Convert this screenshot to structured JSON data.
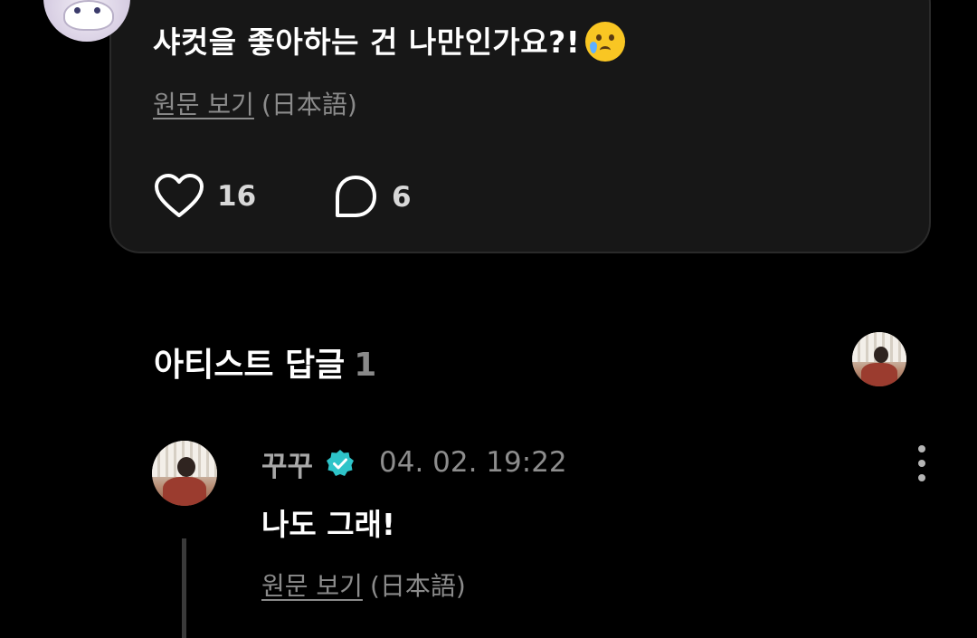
{
  "post": {
    "text": "샤컷을 좋아하는 건 나만인가요?!",
    "emoji_icon": "crying-face-emoji",
    "original_link": "원문 보기",
    "original_lang": "(日本語)",
    "likes": "16",
    "comments": "6"
  },
  "artist_replies": {
    "title": "아티스트 답글",
    "count": "1"
  },
  "reply": {
    "author": "꾸꾸",
    "timestamp": "04. 02. 19:22",
    "text": "나도 그래!",
    "original_link": "원문 보기",
    "original_lang": "(日本語)",
    "verified_icon": "verified-badge-icon"
  },
  "colors": {
    "background": "#000000",
    "card": "#171717",
    "accent_verified": "#2ec4c9",
    "muted_text": "#8b8b8b"
  }
}
